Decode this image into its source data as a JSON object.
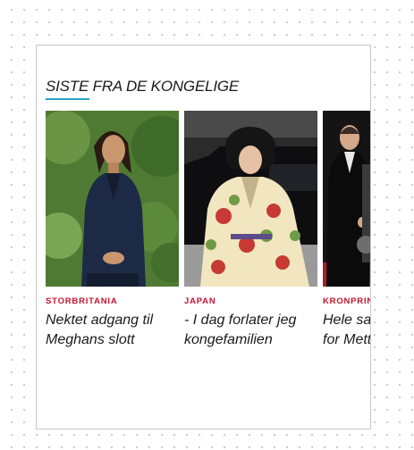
{
  "widget": {
    "title": "SISTE FRA DE KONGELIGE"
  },
  "colors": {
    "accent_underline": "#2aa0c4",
    "category_red": "#c41230"
  },
  "cards": [
    {
      "category": "STORBRITANIA",
      "headline": "Nektet adgang til Meghans slott",
      "image_icon": "photo-woman-navy-blazer"
    },
    {
      "category": "JAPAN",
      "headline": "- I dag forlater jeg kongefamilien",
      "image_icon": "photo-woman-kimono"
    },
    {
      "category": "KRONPRINS",
      "headline": "Hele salen reiste seg for Mette Marit",
      "image_icon": "photo-man-suit-red-carpet"
    }
  ]
}
